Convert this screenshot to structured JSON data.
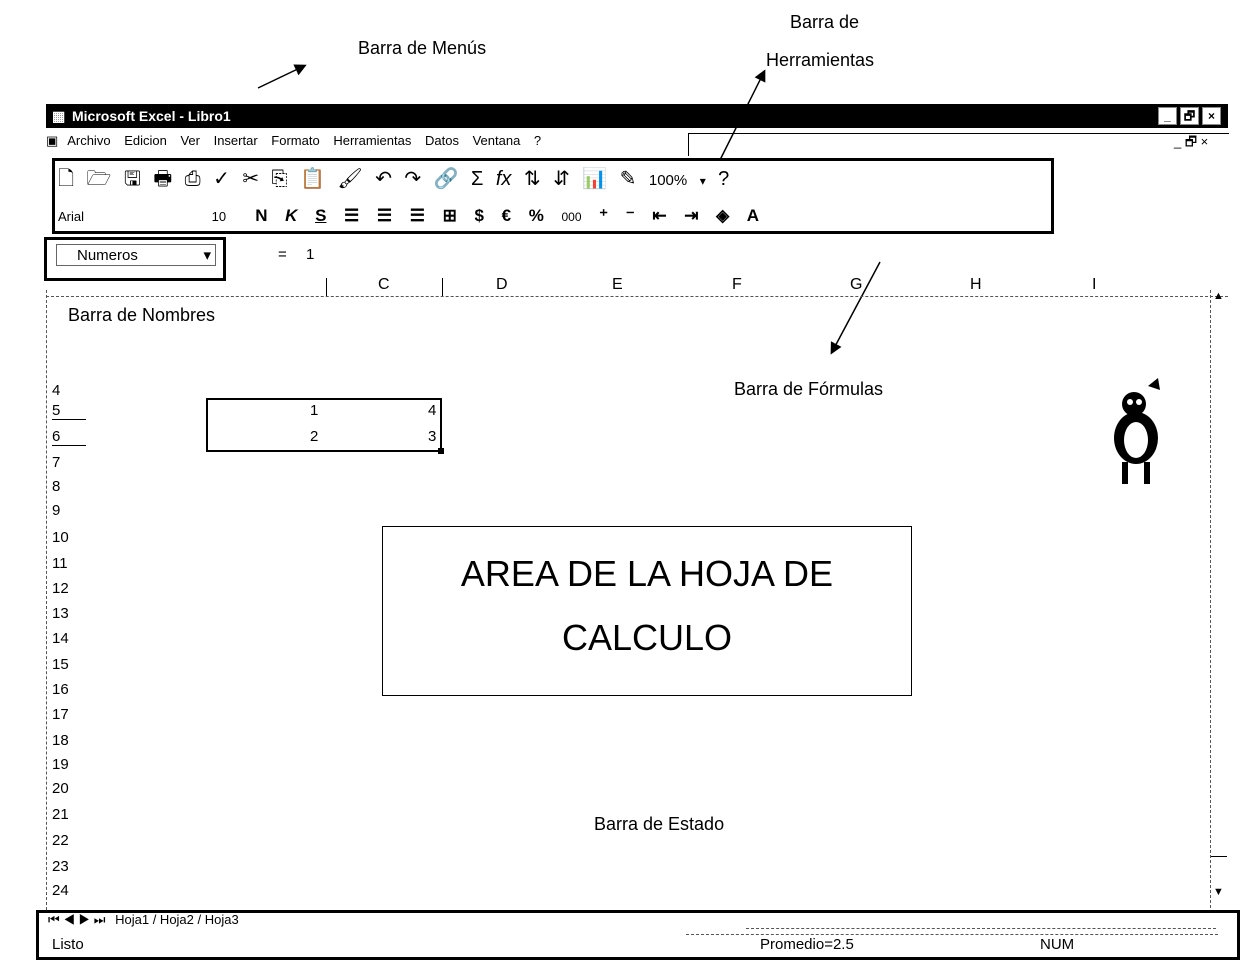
{
  "annotations": {
    "menus": "Barra de Menús",
    "toolbars_line1": "Barra de",
    "toolbars_line2": "Herramientas",
    "names": "Barra de Nombres",
    "formulas": "Barra de Fórmulas",
    "status": "Barra de Estado"
  },
  "window": {
    "title": "Microsoft Excel - Libro1",
    "minimize": "_",
    "restore": "🗗",
    "close": "×"
  },
  "menu": {
    "items": [
      "Archivo",
      "Edicion",
      "Ver",
      "Insertar",
      "Formato",
      "Herramientas",
      "Datos",
      "Ventana",
      "?"
    ]
  },
  "toolbar": {
    "zoom": "100%",
    "icons": [
      "new-file-icon",
      "open-folder-icon",
      "save-icon",
      "print-icon",
      "print-preview-icon",
      "spellcheck-icon",
      "cut-icon",
      "copy-icon",
      "paste-icon",
      "format-painter-icon",
      "undo-icon",
      "redo-icon",
      "hyperlink-icon",
      "autosum-icon",
      "function-icon",
      "sort-ascending-icon",
      "sort-descending-icon",
      "chart-wizard-icon",
      "drawing-icon",
      "help-icon"
    ]
  },
  "format_bar": {
    "font": "Arial",
    "size": "10",
    "bold": "N",
    "italic": "K",
    "underline": "S",
    "currency": "$",
    "euro": "€",
    "percent": "%",
    "thousands": "000",
    "font_color": "A"
  },
  "name_box": {
    "value": "Numeros"
  },
  "formula_bar": {
    "equals": "=",
    "value": "1"
  },
  "columns": [
    "C",
    "D",
    "E",
    "F",
    "G",
    "H",
    "I"
  ],
  "rows": [
    "4",
    "5",
    "6",
    "7",
    "8",
    "9",
    "10",
    "11",
    "12",
    "13",
    "14",
    "15",
    "16",
    "17",
    "18",
    "19",
    "20",
    "21",
    "22",
    "23",
    "24"
  ],
  "cells": {
    "r5c1": "1",
    "r5c2": "4",
    "r6c1": "2",
    "r6c2": "3"
  },
  "area_label": {
    "line1": "AREA DE LA HOJA DE",
    "line2": "CALCULO"
  },
  "sheet_tabs": {
    "text": "Hoja1 / Hoja2 / Hoja3"
  },
  "status_bar": {
    "ready": "Listo",
    "average": "Promedio=2.5",
    "num": "NUM"
  }
}
